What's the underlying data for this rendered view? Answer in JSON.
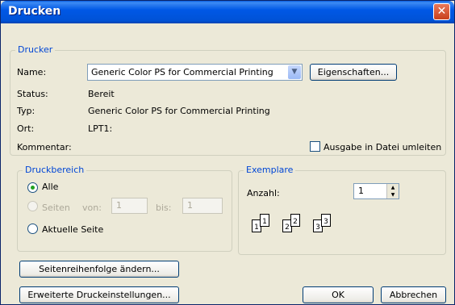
{
  "window": {
    "title": "Drucken"
  },
  "printer": {
    "group_label": "Drucker",
    "name_label": "Name:",
    "name_value": "Generic Color PS for Commercial Printing",
    "properties_button": "Eigenschaften...",
    "status_label": "Status:",
    "status_value": "Bereit",
    "type_label": "Typ:",
    "type_value": "Generic Color PS for Commercial Printing",
    "location_label": "Ort:",
    "location_value": "LPT1:",
    "comment_label": "Kommentar:",
    "print_to_file_label": "Ausgabe in Datei umleiten",
    "print_to_file_checked": false
  },
  "print_range": {
    "group_label": "Druckbereich",
    "all_label": "Alle",
    "pages_label": "Seiten",
    "from_label": "von:",
    "from_value": "1",
    "to_label": "bis:",
    "to_value": "1",
    "current_page_label": "Aktuelle Seite",
    "selected": "all"
  },
  "copies": {
    "group_label": "Exemplare",
    "count_label": "Anzahl:",
    "count_value": "1",
    "collate_pages": [
      "1",
      "1",
      "2",
      "2",
      "3",
      "3"
    ]
  },
  "buttons": {
    "page_order": "Seitenreihenfolge ändern...",
    "advanced": "Erweiterte Druckeinstellungen...",
    "ok": "OK",
    "cancel": "Abbrechen"
  },
  "icons": {
    "close": "close-icon",
    "dropdown": "chevron-down-icon",
    "spin_up": "arrow-up-icon",
    "spin_down": "arrow-down-icon",
    "collate": "collate-pages-icon"
  },
  "colors": {
    "titlebar": "#0058e6",
    "dialog_bg": "#ece9d8",
    "group_label": "#0046d5",
    "close_button": "#c8401c",
    "radio_selected": "#21a121"
  }
}
